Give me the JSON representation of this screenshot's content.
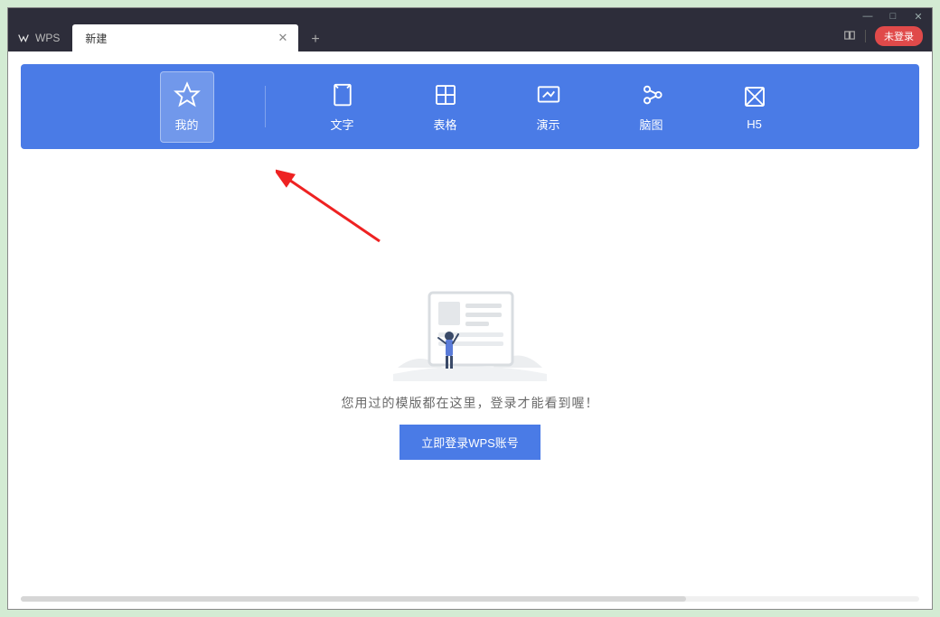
{
  "window": {
    "app_name": "WPS",
    "tabs": [
      {
        "label": "新建",
        "active": true
      }
    ],
    "login_badge": "未登录"
  },
  "categories": [
    {
      "key": "mine",
      "label": "我的",
      "icon": "star-icon",
      "active": true
    },
    {
      "key": "text",
      "label": "文字",
      "icon": "document-icon",
      "active": false
    },
    {
      "key": "sheet",
      "label": "表格",
      "icon": "table-icon",
      "active": false
    },
    {
      "key": "slides",
      "label": "演示",
      "icon": "presentation-icon",
      "active": false
    },
    {
      "key": "mindmap",
      "label": "脑图",
      "icon": "mindmap-icon",
      "active": false
    },
    {
      "key": "h5",
      "label": "H5",
      "icon": "h5-icon",
      "active": false
    }
  ],
  "empty_state": {
    "message": "您用过的模版都在这里，登录才能看到喔！",
    "login_button": "立即登录WPS账号"
  },
  "annotation": {
    "present": true,
    "color": "#e22"
  }
}
